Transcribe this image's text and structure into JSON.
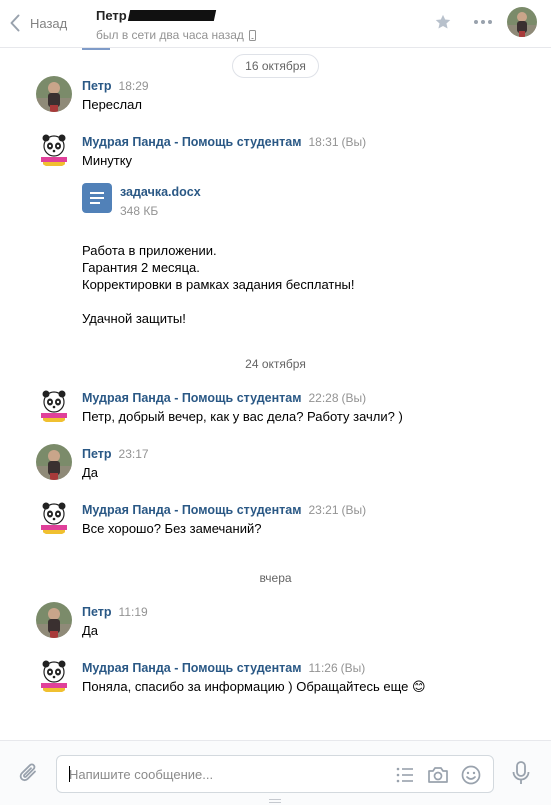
{
  "header": {
    "back_label": "Назад",
    "peer_name": "Петр",
    "peer_status": "был в сети два часа назад"
  },
  "history": {
    "separators": [
      "16 октября",
      "24 октября",
      "вчера"
    ],
    "messages": [
      {
        "author": "Петр",
        "time": "18:29",
        "you": "",
        "lines": [
          "Переслал"
        ]
      },
      {
        "author": "Мудрая Панда - Помощь студентам",
        "time": "18:31",
        "you": "(Вы)",
        "lines": [
          "Минутку"
        ],
        "attachment": {
          "name": "задачка.docx",
          "size": "348 КБ",
          "icon": "document-icon"
        },
        "lines_after": [
          "Работа в приложении.",
          "Гарантия 2 месяца.",
          "Корректировки в рамках задания бесплатны!",
          "",
          "Удачной защиты!"
        ]
      },
      {
        "author": "Мудрая Панда - Помощь студентам",
        "time": "22:28",
        "you": "(Вы)",
        "lines": [
          "Петр, добрый вечер, как у вас дела? Работу зачли? )"
        ]
      },
      {
        "author": "Петр",
        "time": "23:17",
        "you": "",
        "lines": [
          "Да"
        ]
      },
      {
        "author": "Мудрая Панда - Помощь студентам",
        "time": "23:21",
        "you": "(Вы)",
        "lines": [
          "Все хорошо? Без замечаний?"
        ]
      },
      {
        "author": "Петр",
        "time": "11:19",
        "you": "",
        "lines": [
          "Да"
        ]
      },
      {
        "author": "Мудрая Панда - Помощь студентам",
        "time": "11:26",
        "you": "(Вы)",
        "lines": [
          "Поняла, спасибо за информацию ) Обращайтесь еще"
        ],
        "emoji": "😊"
      }
    ]
  },
  "composer": {
    "placeholder": "Напишите сообщение..."
  },
  "icons": {
    "back": "chevron-left-icon",
    "star": "star-icon",
    "more": "more-dots-icon",
    "phone": "phone-icon",
    "attach": "paperclip-icon",
    "template": "list-icon",
    "camera": "camera-icon",
    "emoji": "smile-icon",
    "mic": "microphone-icon"
  },
  "colors": {
    "link": "#2a5885",
    "accent": "#5181b8",
    "muted": "#939393",
    "icon": "#99a2ad"
  }
}
